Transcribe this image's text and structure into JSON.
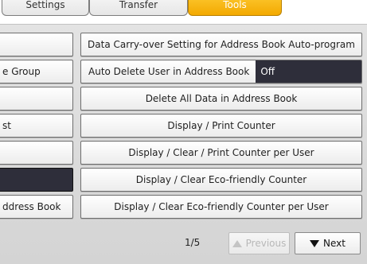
{
  "tabs": [
    {
      "label": "Settings",
      "active": false
    },
    {
      "label": "Transfer",
      "active": false
    },
    {
      "label": "Tools",
      "active": true
    }
  ],
  "left_column": [
    {
      "label": ""
    },
    {
      "label": "e Group"
    },
    {
      "label": ""
    },
    {
      "label": "st"
    },
    {
      "label": ""
    },
    {
      "label": ""
    },
    {
      "label": "ddress Book"
    }
  ],
  "right_column": [
    {
      "label": "Data Carry-over Setting for Address Book Auto-program"
    },
    {
      "label": "Auto Delete User in Address Book",
      "status": "Off"
    },
    {
      "label": "Delete All Data in Address Book"
    },
    {
      "label": "Display / Print Counter"
    },
    {
      "label": "Display / Clear / Print Counter per User"
    },
    {
      "label": "Display / Clear Eco-friendly Counter"
    },
    {
      "label": "Display / Clear Eco-friendly Counter per User"
    }
  ],
  "pager": {
    "count": "1/5",
    "previous_label": "Previous",
    "next_label": "Next",
    "previous_enabled": false
  },
  "colors": {
    "active_tab": "#f3a900",
    "status_bg": "#2e2e3a",
    "panel_bg": "#d9d9d9"
  }
}
